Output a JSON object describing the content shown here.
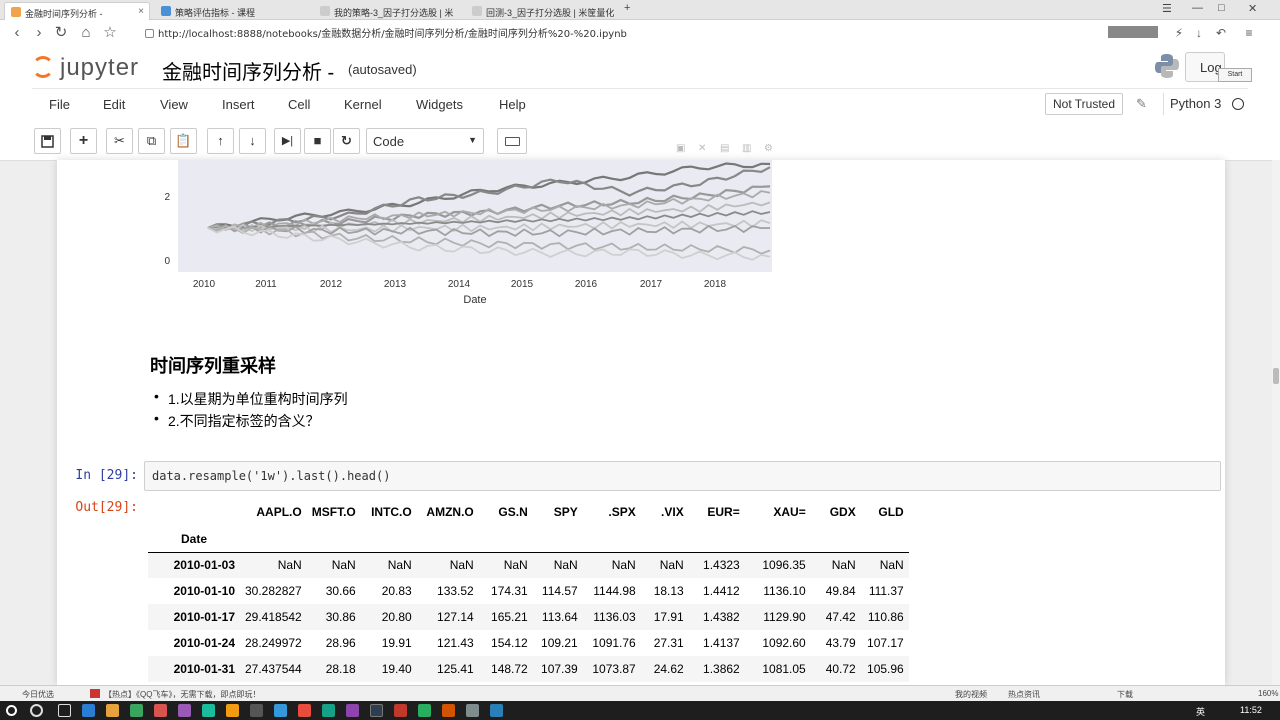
{
  "browser": {
    "tabs": [
      {
        "label": "金融时间序列分析 -"
      },
      {
        "label": "策略评估指标 - 课程"
      },
      {
        "label": "我的策略-3_因子打分选股 | 米"
      },
      {
        "label": "回测-3_因子打分选股 | 米筐量化"
      }
    ],
    "new_tab": "+",
    "url": "http://localhost:8888/notebooks/金融数据分析/金融时间序列分析/金融时间序列分析%20-%20.ipynb"
  },
  "jupyter": {
    "logo_text": "jupyter",
    "notebook_title": "金融时间序列分析 -",
    "autosave": "(autosaved)",
    "logout_label": "Log",
    "start_tooltip": "Start",
    "menu": [
      "File",
      "Edit",
      "View",
      "Insert",
      "Cell",
      "Kernel",
      "Widgets",
      "Help"
    ],
    "trust_label": "Not Trusted",
    "kernel_name": "Python 3",
    "cell_type": "Code"
  },
  "chart_data": {
    "type": "line",
    "title": "",
    "xlabel": "Date",
    "ylabel": "",
    "x_ticks": [
      "2010",
      "2011",
      "2012",
      "2013",
      "2014",
      "2015",
      "2016",
      "2017",
      "2018"
    ],
    "y_ticks": [
      "0",
      "2"
    ],
    "ylim": [
      0,
      3
    ],
    "grid": false,
    "series": [
      {
        "values": [
          1.0,
          1.3,
          1.5,
          1.8,
          2.2,
          2.4,
          2.6,
          2.9,
          3.0
        ]
      },
      {
        "values": [
          1.0,
          1.2,
          1.4,
          1.9,
          2.1,
          2.5,
          2.1,
          2.4,
          2.9
        ]
      },
      {
        "values": [
          1.0,
          1.1,
          1.2,
          1.4,
          1.5,
          1.7,
          1.8,
          2.0,
          2.3
        ]
      },
      {
        "values": [
          1.0,
          1.1,
          1.3,
          1.4,
          1.5,
          1.6,
          1.7,
          1.9,
          2.1
        ]
      },
      {
        "values": [
          1.0,
          1.0,
          1.1,
          1.2,
          1.3,
          1.4,
          1.5,
          1.6,
          1.8
        ]
      },
      {
        "values": [
          1.0,
          1.05,
          1.1,
          1.15,
          1.2,
          1.25,
          1.3,
          1.4,
          1.5
        ]
      },
      {
        "values": [
          1.0,
          1.0,
          0.95,
          1.0,
          1.0,
          1.05,
          1.1,
          1.1,
          1.15
        ]
      },
      {
        "values": [
          1.0,
          0.95,
          0.9,
          0.9,
          0.85,
          0.85,
          0.9,
          0.95,
          1.0
        ]
      },
      {
        "values": [
          1.0,
          0.9,
          0.7,
          0.6,
          0.5,
          0.45,
          0.4,
          0.35,
          0.3
        ]
      },
      {
        "values": [
          1.0,
          0.8,
          0.6,
          0.4,
          0.3,
          0.2,
          0.25,
          0.15,
          0.1
        ]
      }
    ]
  },
  "markdown": {
    "title": "时间序列重采样",
    "bullets": [
      "1.以星期为单位重构时间序列",
      "2.不同指定标签的含义？"
    ]
  },
  "cell": {
    "in_prompt": "In  [29]:",
    "code": "data.resample('1w').last().head()",
    "out_prompt": "Out[29]:"
  },
  "dataframe": {
    "columns": [
      "AAPL.O",
      "MSFT.O",
      "INTC.O",
      "AMZN.O",
      "GS.N",
      "SPY",
      ".SPX",
      ".VIX",
      "EUR=",
      "XAU=",
      "GDX",
      "GLD"
    ],
    "index_name": "Date",
    "rows": [
      {
        "date": "2010-01-03",
        "values": [
          "NaN",
          "NaN",
          "NaN",
          "NaN",
          "NaN",
          "NaN",
          "NaN",
          "NaN",
          "1.4323",
          "1096.35",
          "NaN",
          "NaN"
        ]
      },
      {
        "date": "2010-01-10",
        "values": [
          "30.282827",
          "30.66",
          "20.83",
          "133.52",
          "174.31",
          "114.57",
          "1144.98",
          "18.13",
          "1.4412",
          "1136.10",
          "49.84",
          "111.37"
        ]
      },
      {
        "date": "2010-01-17",
        "values": [
          "29.418542",
          "30.86",
          "20.80",
          "127.14",
          "165.21",
          "113.64",
          "1136.03",
          "17.91",
          "1.4382",
          "1129.90",
          "47.42",
          "110.86"
        ]
      },
      {
        "date": "2010-01-24",
        "values": [
          "28.249972",
          "28.96",
          "19.91",
          "121.43",
          "154.12",
          "109.21",
          "1091.76",
          "27.31",
          "1.4137",
          "1092.60",
          "43.79",
          "107.17"
        ]
      },
      {
        "date": "2010-01-31",
        "values": [
          "27.437544",
          "28.18",
          "19.40",
          "125.41",
          "148.72",
          "107.39",
          "1073.87",
          "24.62",
          "1.3862",
          "1081.05",
          "40.72",
          "105.96"
        ]
      }
    ]
  },
  "statusbar": {
    "left": "今日优选",
    "news": "【热点】《QQ飞车》，无需下载，即点即玩！",
    "video": "我的视频",
    "hot": "热点资讯",
    "download": "下载",
    "zoom": "160%"
  },
  "taskbar": {
    "ime": "英",
    "clock": "11:52"
  }
}
